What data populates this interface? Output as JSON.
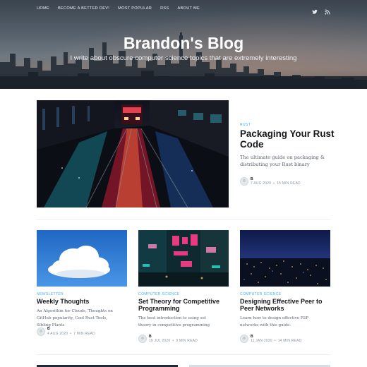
{
  "nav": {
    "links": [
      "HOME",
      "BECOME A BETTER DEV!",
      "MOST POPULAR",
      "RSS",
      "ABOUT ME"
    ],
    "social": [
      "twitter-icon",
      "rss-icon"
    ]
  },
  "hero": {
    "title": "Brandon's Blog",
    "description": "I write about obscure computer science topics that are extremely interesting"
  },
  "featured": {
    "tag": "RUST",
    "title": "Packaging Your Rust Code",
    "excerpt": "The ultimate guide on packaging & distributing your Rust binary",
    "author": "B",
    "date": "7 AUG 2020",
    "read_time": "15 MIN READ"
  },
  "cards": [
    {
      "tag": "NEWSLETTER",
      "title": "Weekly Thoughts",
      "excerpt": "An Algorithm for Clouds, Thoughts on GitHub popularity, Cool Rust Tools, Sibling Plants",
      "author": "B",
      "date": "4 AUG 2020",
      "read_time": "7 MIN READ"
    },
    {
      "tag": "COMPUTER SCIENCE",
      "title": "Set Theory for Competitive Programming",
      "excerpt": "The best introduction to using set theory in competitive programming",
      "author": "B",
      "date": "16 JUL 2020",
      "read_time": "9 MIN READ"
    },
    {
      "tag": "COMPUTER SCIENCE",
      "title": "Designing Effective Peer to Peer Networks",
      "excerpt": "Learn how to design effective P2P networks with this guide.",
      "author": "B",
      "date": "11 JAN 2020",
      "read_time": "14 MIN READ"
    }
  ]
}
